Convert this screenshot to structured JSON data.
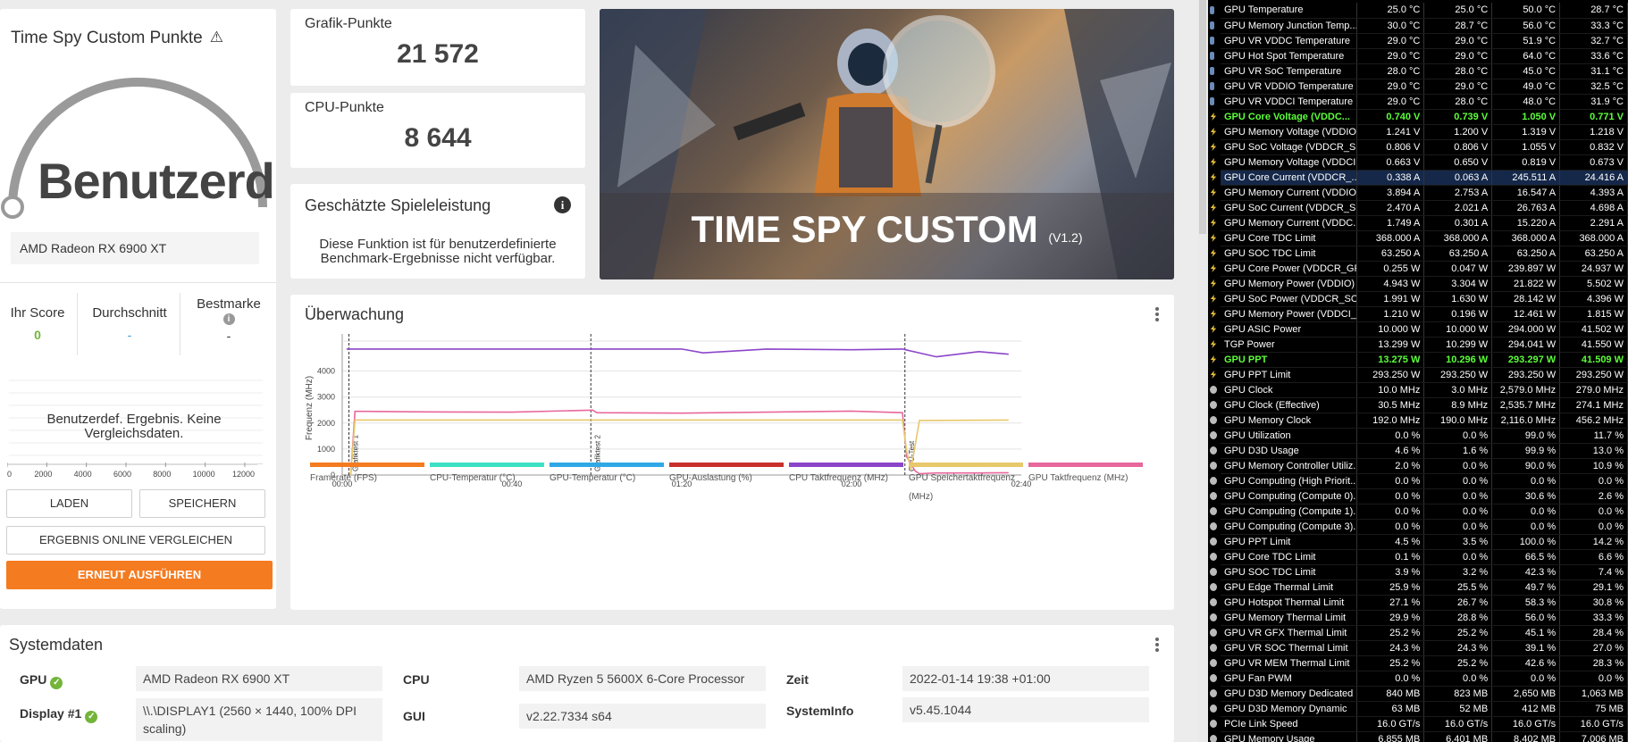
{
  "score_card": {
    "title": "Time Spy Custom Punkte",
    "gauge_text": "Benutzerd",
    "gpu_name": "AMD Radeon RX 6900 XT",
    "columns": [
      {
        "label": "Ihr Score",
        "value": "0"
      },
      {
        "label": "Durchschnitt",
        "value": "-"
      },
      {
        "label": "Bestmarke",
        "value": "-"
      }
    ],
    "no_data": "Benutzerdef. Ergebnis. Keine Vergleichsdaten.",
    "histogram_ticks": [
      "0",
      "2000",
      "4000",
      "6000",
      "8000",
      "10000",
      "12000"
    ],
    "buttons": {
      "load": "LADEN",
      "save": "SPEICHERN",
      "compare": "ERGEBNIS ONLINE VERGLEICHEN",
      "rerun": "ERNEUT AUSFÜHREN"
    }
  },
  "graphics_points": {
    "label": "Grafik-Punkte",
    "value": "21 572"
  },
  "cpu_points": {
    "label": "CPU-Punkte",
    "value": "8 644"
  },
  "game_perf": {
    "title": "Geschätzte Spieleleistung",
    "text": "Diese Funktion ist für benutzerdefinierte Benchmark-Ergebnisse nicht verfügbar."
  },
  "hero": {
    "title": "TIME SPY CUSTOM",
    "version": "(V1.2)"
  },
  "monitoring": {
    "title": "Überwachung",
    "chart_data": {
      "type": "line",
      "ylabel": "Frequenz (MHz)",
      "ylim": [
        0,
        5000
      ],
      "y_ticks": [
        "0",
        "1000",
        "2000",
        "3000",
        "4000"
      ],
      "x_ticks": [
        "00:00",
        "00:40",
        "01:20",
        "02:00",
        "02:40"
      ],
      "xlim_seconds": [
        0,
        160
      ],
      "markers": [
        {
          "label": "Grafiktest 1",
          "t": 2
        },
        {
          "label": "Grafiktest 2",
          "t": 59
        },
        {
          "label": "CPU-Test",
          "t": 133
        }
      ],
      "series": [
        {
          "name": "GPU Taktfrequenz (MHz)",
          "color": "#e8679c",
          "t": [
            2,
            3,
            5,
            20,
            40,
            59,
            60,
            80,
            100,
            120,
            132,
            133,
            135,
            136,
            140,
            150,
            157
          ],
          "y": [
            0,
            2450,
            2450,
            2430,
            2420,
            2500,
            2400,
            2380,
            2420,
            2460,
            2400,
            700,
            150,
            50,
            80,
            80,
            90
          ]
        },
        {
          "name": "GPU Speichertaktfrequenz (MHz)",
          "color": "#e7c86b",
          "t": [
            2,
            3,
            132,
            133,
            134,
            136,
            157
          ],
          "y": [
            0,
            2116,
            2116,
            900,
            200,
            2100,
            2116
          ]
        },
        {
          "name": "CPU Taktfrequenz (MHz)",
          "color": "#8b45c9",
          "t": [
            1,
            59,
            80,
            85,
            100,
            120,
            132,
            140,
            150,
            157
          ],
          "y": [
            4850,
            4850,
            4850,
            4700,
            4850,
            4820,
            4850,
            4550,
            4750,
            4650
          ]
        }
      ],
      "legend": [
        {
          "label": "Framerate (FPS)",
          "color": "#f47b20"
        },
        {
          "label": "CPU-Temperatur (°C)",
          "color": "#3ee0c5"
        },
        {
          "label": "GPU-Temperatur (°C)",
          "color": "#2fa8e6"
        },
        {
          "label": "GPU-Auslastung (%)",
          "color": "#c9302c"
        },
        {
          "label": "CPU Taktfrequenz (MHz)",
          "color": "#8b45c9"
        },
        {
          "label": "GPU Speichertaktfrequenz (MHz)",
          "color": "#e7c86b"
        },
        {
          "label": "GPU Taktfrequenz (MHz)",
          "color": "#e8679c"
        }
      ]
    }
  },
  "system": {
    "title": "Systemdaten",
    "rows": [
      {
        "label": "GPU",
        "value": "AMD Radeon RX 6900 XT"
      },
      {
        "label": "Display #1",
        "value": "\\\\.\\DISPLAY1 (2560 × 1440, 100% DPI scaling)"
      },
      {
        "label": "CPU",
        "value": "AMD Ryzen 5 5600X 6-Core Processor"
      },
      {
        "label": "GUI",
        "value": "v2.22.7334 s64"
      },
      {
        "label": "Zeit",
        "value": "2022-01-14 19:38 +01:00"
      },
      {
        "label": "SystemInfo",
        "value": "v5.45.1044"
      }
    ]
  },
  "sensors": [
    [
      "GPU Temperature",
      "25.0 °C",
      "25.0 °C",
      "50.0 °C",
      "28.7 °C"
    ],
    [
      "GPU Memory Junction Temp...",
      "30.0 °C",
      "28.7 °C",
      "56.0 °C",
      "33.3 °C"
    ],
    [
      "GPU VR VDDC Temperature",
      "29.0 °C",
      "29.0 °C",
      "51.9 °C",
      "32.7 °C"
    ],
    [
      "GPU Hot Spot Temperature",
      "29.0 °C",
      "29.0 °C",
      "64.0 °C",
      "33.6 °C"
    ],
    [
      "GPU VR SoC Temperature",
      "28.0 °C",
      "28.0 °C",
      "45.0 °C",
      "31.1 °C"
    ],
    [
      "GPU VR VDDIO Temperature",
      "29.0 °C",
      "29.0 °C",
      "49.0 °C",
      "32.5 °C"
    ],
    [
      "GPU VR VDDCI Temperature",
      "29.0 °C",
      "28.0 °C",
      "48.0 °C",
      "31.9 °C"
    ],
    [
      "GPU Core Voltage (VDDC...",
      "0.740 V",
      "0.739 V",
      "1.050 V",
      "0.771 V"
    ],
    [
      "GPU Memory Voltage (VDDIO)",
      "1.241 V",
      "1.200 V",
      "1.319 V",
      "1.218 V"
    ],
    [
      "GPU SoC Voltage (VDDCR_S...",
      "0.806 V",
      "0.806 V",
      "1.055 V",
      "0.832 V"
    ],
    [
      "GPU Memory Voltage (VDDCI...",
      "0.663 V",
      "0.650 V",
      "0.819 V",
      "0.673 V"
    ],
    [
      "GPU Core Current (VDDCR_...",
      "0.338 A",
      "0.063 A",
      "245.511 A",
      "24.416 A"
    ],
    [
      "GPU Memory Current (VDDIO)",
      "3.894 A",
      "2.753 A",
      "16.547 A",
      "4.393 A"
    ],
    [
      "GPU SoC Current (VDDCR_S...",
      "2.470 A",
      "2.021 A",
      "26.763 A",
      "4.698 A"
    ],
    [
      "GPU Memory Current (VDDC...",
      "1.749 A",
      "0.301 A",
      "15.220 A",
      "2.291 A"
    ],
    [
      "GPU Core TDC Limit",
      "368.000 A",
      "368.000 A",
      "368.000 A",
      "368.000 A"
    ],
    [
      "GPU SOC TDC Limit",
      "63.250 A",
      "63.250 A",
      "63.250 A",
      "63.250 A"
    ],
    [
      "GPU Core Power (VDDCR_GFX)",
      "0.255 W",
      "0.047 W",
      "239.897 W",
      "24.937 W"
    ],
    [
      "GPU Memory Power (VDDIO)",
      "4.943 W",
      "3.304 W",
      "21.822 W",
      "5.502 W"
    ],
    [
      "GPU SoC Power (VDDCR_SOC)",
      "1.991 W",
      "1.630 W",
      "28.142 W",
      "4.396 W"
    ],
    [
      "GPU Memory Power (VDDCI_...",
      "1.210 W",
      "0.196 W",
      "12.461 W",
      "1.815 W"
    ],
    [
      "GPU ASIC Power",
      "10.000 W",
      "10.000 W",
      "294.000 W",
      "41.502 W"
    ],
    [
      "TGP Power",
      "13.299 W",
      "10.299 W",
      "294.041 W",
      "41.550 W"
    ],
    [
      "GPU PPT",
      "13.275 W",
      "10.296 W",
      "293.297 W",
      "41.509 W"
    ],
    [
      "GPU PPT Limit",
      "293.250 W",
      "293.250 W",
      "293.250 W",
      "293.250 W"
    ],
    [
      "GPU Clock",
      "10.0 MHz",
      "3.0 MHz",
      "2,579.0 MHz",
      "279.0 MHz"
    ],
    [
      "GPU Clock (Effective)",
      "30.5 MHz",
      "8.9 MHz",
      "2,535.7 MHz",
      "274.1 MHz"
    ],
    [
      "GPU Memory Clock",
      "192.0 MHz",
      "190.0 MHz",
      "2,116.0 MHz",
      "456.2 MHz"
    ],
    [
      "GPU Utilization",
      "0.0 %",
      "0.0 %",
      "99.0 %",
      "11.7 %"
    ],
    [
      "GPU D3D Usage",
      "4.6 %",
      "1.6 %",
      "99.9 %",
      "13.0 %"
    ],
    [
      "GPU Memory Controller Utiliz...",
      "2.0 %",
      "0.0 %",
      "90.0 %",
      "10.9 %"
    ],
    [
      "GPU Computing (High Priorit...",
      "0.0 %",
      "0.0 %",
      "0.0 %",
      "0.0 %"
    ],
    [
      "GPU Computing (Compute 0)...",
      "0.0 %",
      "0.0 %",
      "30.6 %",
      "2.6 %"
    ],
    [
      "GPU Computing (Compute 1)...",
      "0.0 %",
      "0.0 %",
      "0.0 %",
      "0.0 %"
    ],
    [
      "GPU Computing (Compute 3)...",
      "0.0 %",
      "0.0 %",
      "0.0 %",
      "0.0 %"
    ],
    [
      "GPU PPT Limit",
      "4.5 %",
      "3.5 %",
      "100.0 %",
      "14.2 %"
    ],
    [
      "GPU Core TDC Limit",
      "0.1 %",
      "0.0 %",
      "66.5 %",
      "6.6 %"
    ],
    [
      "GPU SOC TDC Limit",
      "3.9 %",
      "3.2 %",
      "42.3 %",
      "7.4 %"
    ],
    [
      "GPU Edge Thermal Limit",
      "25.9 %",
      "25.5 %",
      "49.7 %",
      "29.1 %"
    ],
    [
      "GPU Hotspot Thermal Limit",
      "27.1 %",
      "26.7 %",
      "58.3 %",
      "30.8 %"
    ],
    [
      "GPU Memory Thermal Limit",
      "29.9 %",
      "28.8 %",
      "56.0 %",
      "33.3 %"
    ],
    [
      "GPU VR GFX Thermal Limit",
      "25.2 %",
      "25.2 %",
      "45.1 %",
      "28.4 %"
    ],
    [
      "GPU VR SOC Thermal Limit",
      "24.3 %",
      "24.3 %",
      "39.1 %",
      "27.0 %"
    ],
    [
      "GPU VR MEM Thermal Limit",
      "25.2 %",
      "25.2 %",
      "42.6 %",
      "28.3 %"
    ],
    [
      "GPU Fan PWM",
      "0.0 %",
      "0.0 %",
      "0.0 %",
      "0.0 %"
    ],
    [
      "GPU D3D Memory Dedicated",
      "840 MB",
      "823 MB",
      "2,650 MB",
      "1,063 MB"
    ],
    [
      "GPU D3D Memory Dynamic",
      "63 MB",
      "52 MB",
      "412 MB",
      "75 MB"
    ],
    [
      "PCIe Link Speed",
      "16.0 GT/s",
      "16.0 GT/s",
      "16.0 GT/s",
      "16.0 GT/s"
    ],
    [
      "GPU Memory Usage",
      "6,855 MB",
      "6,401 MB",
      "8,402 MB",
      "7,006 MB"
    ]
  ],
  "sensor_highlight_rows": [
    7,
    23
  ],
  "sensor_selected_row": 11
}
